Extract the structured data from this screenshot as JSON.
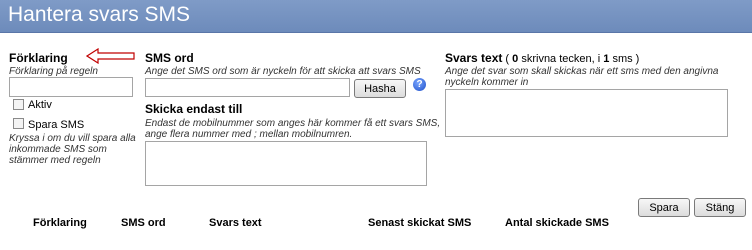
{
  "header": {
    "title": "Hantera svars SMS"
  },
  "description": {
    "label": "Förklaring",
    "hint": "Förklaring på regeln",
    "value": ""
  },
  "active": {
    "label": "Aktiv",
    "checked": false
  },
  "save_sms": {
    "label": "Spara SMS",
    "checked": false,
    "hint": "Kryssa i om du vill spara alla inkommade SMS som stämmer med regeln"
  },
  "sms_word": {
    "label": "SMS ord",
    "hint": "Ange det SMS ord som är nyckeln för att skicka att svars SMS",
    "value": "",
    "hash_button": "Hasha",
    "help_icon": "help-icon"
  },
  "send_only_to": {
    "label": "Skicka endast till",
    "hint": "Endast de mobilnummer som anges här kommer få ett svars SMS, ange flera nummer med ; mellan mobilnumren.",
    "value": ""
  },
  "reply_text": {
    "label": "Svars text",
    "count_open": " ( ",
    "char_count": "0",
    "char_word": " skrivna tecken, i ",
    "sms_count": "1",
    "sms_word": " sms )",
    "hint": "Ange det svar som skall skickas när ett sms med den angivna nyckeln kommer in",
    "value": ""
  },
  "buttons": {
    "save": "Spara",
    "close": "Stäng"
  },
  "table": {
    "columns": [
      "Förklaring",
      "SMS ord",
      "Svars text",
      "Senast skickat SMS",
      "Antal skickade SMS"
    ]
  },
  "colors": {
    "header_bg": "#7591c0",
    "arrow": "#c00000",
    "help_icon": "#1d4fc8"
  }
}
